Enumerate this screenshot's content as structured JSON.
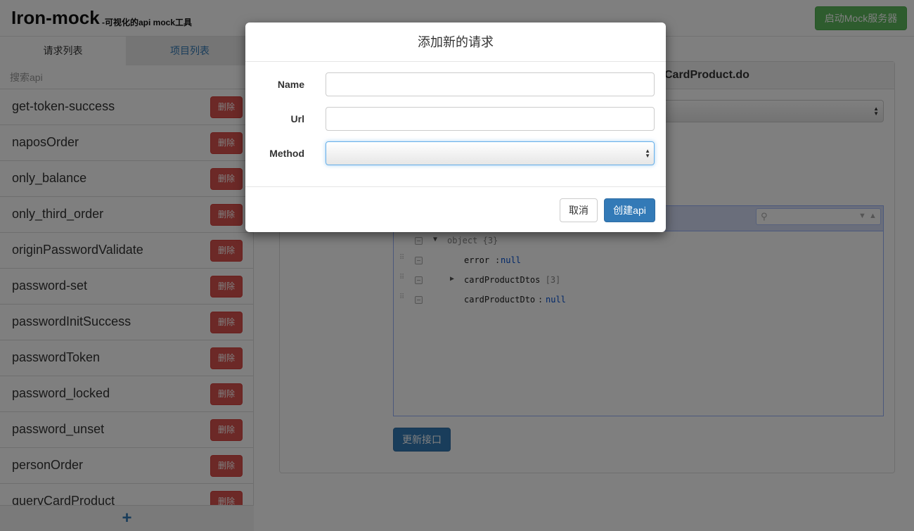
{
  "header": {
    "brand": "Iron-mock",
    "subtitle": "-可视化的api mock工具",
    "start_button": "启动Mock服务器",
    "colors": {
      "start_button": "#5cb85c"
    }
  },
  "sidebar": {
    "tabs": [
      {
        "label": "请求列表"
      },
      {
        "label": "项目列表"
      }
    ],
    "search_placeholder": "搜索api",
    "items": [
      {
        "name": "get-token-success",
        "delete_label": "删除"
      },
      {
        "name": "naposOrder",
        "delete_label": "删除"
      },
      {
        "name": "only_balance",
        "delete_label": "删除"
      },
      {
        "name": "only_third_order",
        "delete_label": "删除"
      },
      {
        "name": "originPasswordValidate",
        "delete_label": "删除"
      },
      {
        "name": "password-set",
        "delete_label": "删除"
      },
      {
        "name": "passwordInitSuccess",
        "delete_label": "删除"
      },
      {
        "name": "passwordToken",
        "delete_label": "删除"
      },
      {
        "name": "password_locked",
        "delete_label": "删除"
      },
      {
        "name": "password_unset",
        "delete_label": "删除"
      },
      {
        "name": "personOrder",
        "delete_label": "删除"
      },
      {
        "name": "queryCardProduct",
        "delete_label": "删除"
      }
    ],
    "add_icon": "+"
  },
  "main": {
    "panel_title": "CardProduct.do",
    "json_editor": {
      "root": {
        "key": "object",
        "meta": "{3}"
      },
      "fields": [
        {
          "key": "error",
          "value": "null"
        },
        {
          "key": "cardProductDtos",
          "meta": "[3]"
        },
        {
          "key": "cardProductDto",
          "value": "null"
        }
      ],
      "icons": [
        "drag-handle-icon",
        "context-menu-icon",
        "expand-arrow-icon",
        "search-icon"
      ]
    },
    "update_button": "更新接口"
  },
  "modal": {
    "title": "添加新的请求",
    "fields": [
      {
        "label": "Name",
        "value": ""
      },
      {
        "label": "Url",
        "value": ""
      },
      {
        "label": "Method",
        "value": ""
      }
    ],
    "cancel_button": "取消",
    "create_button": "创建api",
    "colors": {
      "primary": "#337ab7",
      "danger": "#d9534f"
    }
  }
}
